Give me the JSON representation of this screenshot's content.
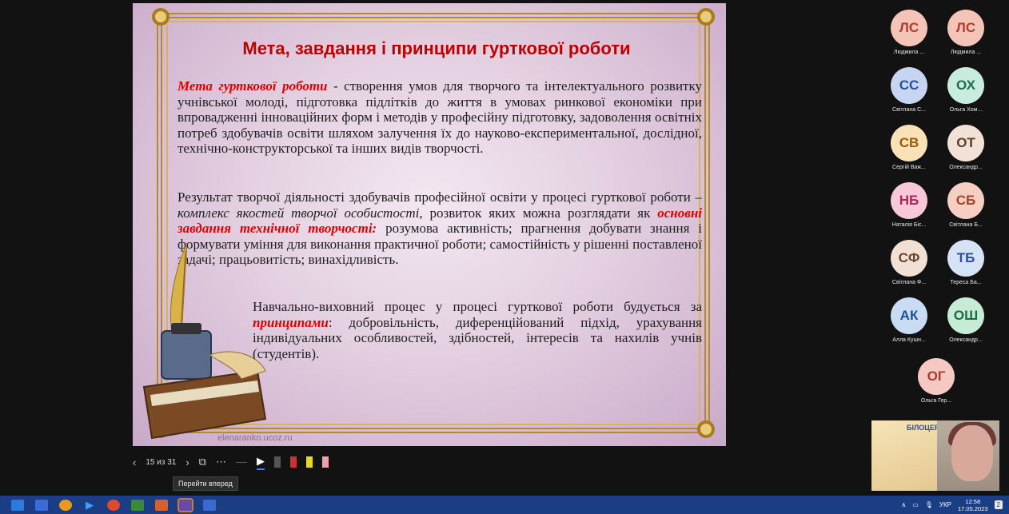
{
  "slide": {
    "title": "Мета, завдання  і принципи  гурткової роботи",
    "p1_lead": "Мета гурткової роботи",
    "p1_text": " - створення умов для творчого та інтелектуального розвитку учнівської молоді, підготовка підлітків до життя в умовах ринкової економіки при впровадженні інноваційних форм і методів у професійну підготовку, задоволення освітніх потреб здобувачів освіти шляхом залучення їх до науково-експериментальної, дослідної, технічно-конструкторської та інших видів творчості.",
    "p2_a": "Результат творчої діяльності здобувачів професійної освіти у процесі гурткової роботи – ",
    "p2_ital": "комплекс якостей творчої особистості",
    "p2_b": ", розвиток яких можна розглядати як ",
    "p2_red": "основні завдання технічної творчості:",
    "p2_c": " розумова активність; прагнення добувати знання і формувати уміння для виконання практичної роботи; самостійність у рішенні поставленої задачі; працьовитість; винахідливість.",
    "p3_a": "Навчально-виховний процес  у процесі гурткової роботи будується за ",
    "p3_red": "принципами",
    "p3_b": ": добровільність, диференційований підхід, урахування індивідуальних особливостей,  здібностей, інтересів та нахилів учнів (студентів).",
    "watermark": "elenaranko.ucoz.ru"
  },
  "controls": {
    "prev": "‹",
    "counter": "15 из 31",
    "next": "›",
    "tooltip": "Перейти вперед"
  },
  "participants": [
    {
      "initials": "ЛС",
      "name": "Людмила ...",
      "bg": "#f4c4b8",
      "fg": "#b03a2e"
    },
    {
      "initials": "ЛС",
      "name": "Людмила ...",
      "bg": "#f4c4b8",
      "fg": "#b03a2e"
    },
    {
      "initials": "СС",
      "name": "Світлана С...",
      "bg": "#c6d6f2",
      "fg": "#2d4f9a"
    },
    {
      "initials": "ОХ",
      "name": "Ольга Хом...",
      "bg": "#c8ecde",
      "fg": "#1e6e4e"
    },
    {
      "initials": "СВ",
      "name": "Сергій Важ...",
      "bg": "#fbe1b8",
      "fg": "#9a5a10"
    },
    {
      "initials": "ОТ",
      "name": "Олександр...",
      "bg": "#f1e2d5",
      "fg": "#5a3d2a"
    },
    {
      "initials": "НБ",
      "name": "Наталія Біс...",
      "bg": "#f6c8d8",
      "fg": "#a8285a"
    },
    {
      "initials": "СБ",
      "name": "Світлана Б...",
      "bg": "#f7cfc2",
      "fg": "#a8402a"
    },
    {
      "initials": "СФ",
      "name": "Світлана Ф...",
      "bg": "#f2e0d5",
      "fg": "#6a4632"
    },
    {
      "initials": "ТБ",
      "name": "Тереса Ба...",
      "bg": "#d6e2f6",
      "fg": "#2d4f9a"
    },
    {
      "initials": "АК",
      "name": "Алла Кушн...",
      "bg": "#c9dcf3",
      "fg": "#1f4f98"
    },
    {
      "initials": "ОШ",
      "name": "Олександр...",
      "bg": "#c6ecd6",
      "fg": "#1e6a44"
    },
    {
      "initials": "ОГ",
      "name": "Ольга Гер...",
      "bg": "#f6c8c2",
      "fg": "#a83a2e"
    }
  ],
  "video": {
    "banner_title": "БІЛОЦЕРК НЕПЕРЕРВН"
  },
  "taskbar": {
    "lang": "УКР",
    "time": "12:58",
    "date": "17.05.2023"
  }
}
